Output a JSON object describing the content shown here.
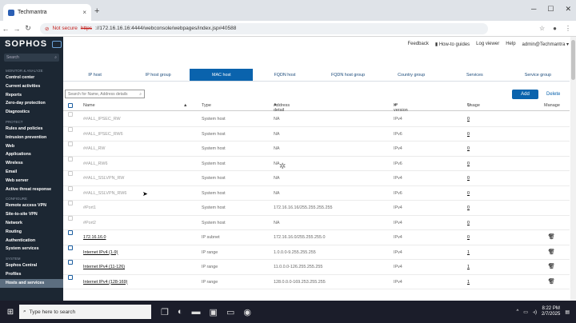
{
  "browser": {
    "tab_title": "Techmantra",
    "tab_close": "×",
    "new_tab": "+",
    "win_min": "─",
    "win_max": "☐",
    "win_close": "✕",
    "not_secure": "Not secure",
    "url_scheme": "https",
    "url_rest": "://172.16.16.16:4444/webconsole/webpages/index.jsp#40588"
  },
  "sidebar": {
    "logo": "SOPHOS",
    "search_placeholder": "Search",
    "sections": [
      {
        "title": "MONITOR & ANALYZE",
        "items": [
          "Control center",
          "Current activities",
          "Reports",
          "Zero-day protection",
          "Diagnostics"
        ]
      },
      {
        "title": "PROTECT",
        "items": [
          "Rules and policies",
          "Intrusion prevention",
          "Web",
          "Applications",
          "Wireless",
          "Email",
          "Web server",
          "Active threat response"
        ]
      },
      {
        "title": "CONFIGURE",
        "items": [
          "Remote access VPN",
          "Site-to-site VPN",
          "Network",
          "Routing",
          "Authentication",
          "System services"
        ]
      },
      {
        "title": "SYSTEM",
        "items": [
          "Sophos Central",
          "Profiles",
          "Hosts and services"
        ]
      }
    ]
  },
  "top_links": {
    "feedback": "Feedback",
    "how_to": "How-to guides",
    "log_viewer": "Log viewer",
    "help": "Help",
    "user": "admin@Techmantra"
  },
  "tabs": [
    "IP host",
    "IP host group",
    "MAC host",
    "FQDN host",
    "FQDN host group",
    "Country group",
    "Services",
    "Service group"
  ],
  "active_tab": "MAC host",
  "search": {
    "placeholder": "Search for Name, Address details"
  },
  "buttons": {
    "add": "Add",
    "delete": "Delete"
  },
  "table": {
    "headers": {
      "name": "Name",
      "type": "Type",
      "address": "Address detail",
      "ip_version": "IP version",
      "usage": "Usage",
      "manage": "Manage"
    },
    "rows": [
      {
        "name": "##ALL_IPSEC_RW",
        "type": "System host",
        "address": "NA",
        "ip": "IPv4",
        "usage": "0",
        "system": true
      },
      {
        "name": "##ALL_IPSEC_RW6",
        "type": "System host",
        "address": "NA",
        "ip": "IPv6",
        "usage": "0",
        "system": true
      },
      {
        "name": "##ALL_RW",
        "type": "System host",
        "address": "NA",
        "ip": "IPv4",
        "usage": "0",
        "system": true
      },
      {
        "name": "##ALL_RW6",
        "type": "System host",
        "address": "NA",
        "ip": "IPv6",
        "usage": "0",
        "system": true
      },
      {
        "name": "##ALL_SSLVPN_RW",
        "type": "System host",
        "address": "NA",
        "ip": "IPv4",
        "usage": "0",
        "system": true
      },
      {
        "name": "##ALL_SSLVPN_RW6",
        "type": "System host",
        "address": "NA",
        "ip": "IPv6",
        "usage": "0",
        "system": true
      },
      {
        "name": "#Port1",
        "type": "System host",
        "address": "172.16.16.16/255.255.255.255",
        "ip": "IPv4",
        "usage": "0",
        "system": true
      },
      {
        "name": "#Port2",
        "type": "System host",
        "address": "NA",
        "ip": "IPv4",
        "usage": "0",
        "system": true
      },
      {
        "name": "172.16.16.0",
        "type": "IP subnet",
        "address": "172.16.16.0/255.255.255.0",
        "ip": "IPv4",
        "usage": "0",
        "system": false
      },
      {
        "name": "Internet IPv4 (1-9)",
        "type": "IP range",
        "address": "1.0.0.0-9.255.255.255",
        "ip": "IPv4",
        "usage": "1",
        "system": false
      },
      {
        "name": "Internet IPv4 (11-126)",
        "type": "IP range",
        "address": "11.0.0.0-126.255.255.255",
        "ip": "IPv4",
        "usage": "1",
        "system": false
      },
      {
        "name": "Internet IPv4 (128-169)",
        "type": "IP range",
        "address": "128.0.0.0-169.253.255.255",
        "ip": "IPv4",
        "usage": "1",
        "system": false
      }
    ]
  },
  "taskbar": {
    "search_placeholder": "Type here to search",
    "time": "8:22 PM",
    "date": "2/7/2025"
  }
}
